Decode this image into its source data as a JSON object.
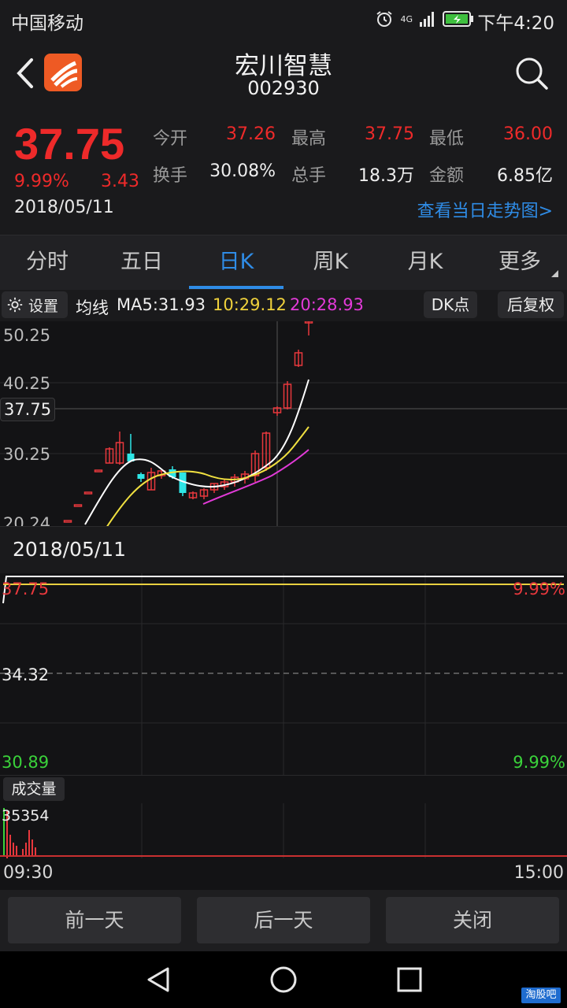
{
  "status_bar": {
    "carrier": "中国移动",
    "time": "下午4:20",
    "network": "4G"
  },
  "header": {
    "stock_name": "宏川智慧",
    "stock_code": "002930",
    "icons": [
      "back-icon",
      "app-logo",
      "search-icon"
    ]
  },
  "quote": {
    "price": "37.75",
    "change_pct": "9.99%",
    "change": "3.43",
    "date": "2018/05/11",
    "stats": [
      {
        "label": "今开",
        "value": "37.26",
        "color": "#ee2a2a"
      },
      {
        "label": "最高",
        "value": "37.75",
        "color": "#ee2a2a"
      },
      {
        "label": "最低",
        "value": "36.00",
        "color": "#ee2a2a"
      },
      {
        "label": "换手",
        "value": "30.08%",
        "color": "#eeeeee"
      },
      {
        "label": "总手",
        "value": "18.3万",
        "color": "#eeeeee"
      },
      {
        "label": "金额",
        "value": "6.85亿",
        "color": "#eeeeee"
      }
    ],
    "trend_link": "查看当日走势图>"
  },
  "tabs": [
    {
      "label": "分时",
      "active": false
    },
    {
      "label": "五日",
      "active": false
    },
    {
      "label": "日K",
      "active": true
    },
    {
      "label": "周K",
      "active": false
    },
    {
      "label": "月K",
      "active": false
    },
    {
      "label": "更多",
      "active": false
    }
  ],
  "indicators": {
    "settings_label": "设置",
    "ma_label": "均线",
    "ma5": "MA5:31.93",
    "ma10": "10:29.12",
    "ma20": "20:28.93",
    "dk_label": "DK点",
    "adjust_label": "后复权"
  },
  "kline": {
    "axis_labels": [
      "50.25",
      "40.25",
      "30.25",
      "20.24"
    ],
    "current_price_tag": "37.75",
    "colors": {
      "up": "#e8383d",
      "down": "#2ee6e6",
      "ma5": "#ffffff",
      "ma10": "#f0e040",
      "ma20": "#e23ad8"
    }
  },
  "intraday": {
    "date": "2018/05/11",
    "top_price": "37.75",
    "top_pct": "9.99%",
    "mid_price": "34.32",
    "bottom_price": "30.89",
    "bottom_pct": "9.99%",
    "volume_label": "成交量",
    "volume_value": "35354",
    "time_start": "09:30",
    "time_end": "15:00"
  },
  "footer": {
    "prev_day": "前一天",
    "next_day": "后一天",
    "close": "关闭"
  },
  "watermark": "淘股吧"
}
